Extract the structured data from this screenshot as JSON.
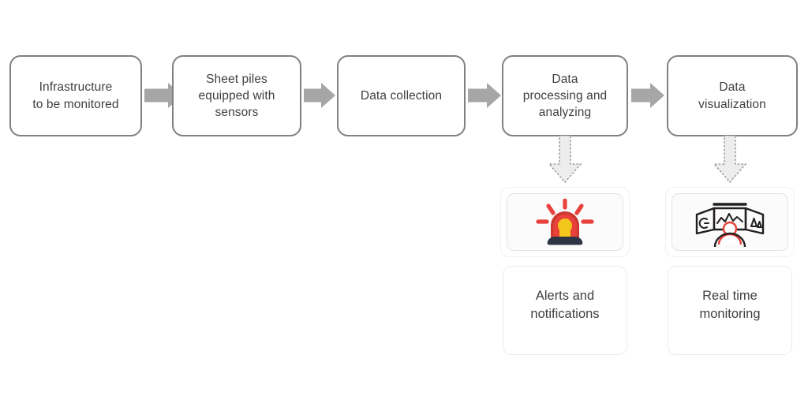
{
  "diagram": {
    "type": "flowchart",
    "orientation": "left-to-right with downward branches",
    "process_steps": [
      {
        "id": "infrastructure",
        "label": "Infrastructure\nto be monitored",
        "lines": [
          "Infrastructure",
          "to be monitored"
        ]
      },
      {
        "id": "sheet-piles",
        "label": "Sheet piles\nequipped with\nsensors",
        "lines": [
          "Sheet piles",
          "equipped with",
          "sensors"
        ]
      },
      {
        "id": "data-collection",
        "label": "Data collection",
        "lines": [
          "Data collection"
        ]
      },
      {
        "id": "data-processing",
        "label": "Data\nprocessing and\nanalyzing",
        "lines": [
          "Data",
          "processing and",
          "analyzing"
        ]
      },
      {
        "id": "data-visualization",
        "label": "Data\nvisualization",
        "lines": [
          "Data",
          "visualization"
        ]
      }
    ],
    "outcomes": [
      {
        "id": "alerts",
        "icon_name": "siren-alert-icon",
        "label": "Alerts and\nnotifications",
        "lines": [
          "Alerts and",
          "notifications"
        ],
        "source_step": "data-processing"
      },
      {
        "id": "realtime",
        "icon_name": "control-room-monitoring-icon",
        "label": "Real time\nmonitoring",
        "lines": [
          "Real time",
          "monitoring"
        ],
        "source_step": "data-visualization"
      }
    ],
    "connectors": {
      "horizontal_arrow_count": 4,
      "horizontal_arrow_style": "solid block arrow",
      "vertical_arrow_count": 2,
      "vertical_arrow_style": "dashed outline block arrow"
    }
  },
  "colors": {
    "box_border": "#808080",
    "box_fill": "#ffffff",
    "text": "#3f3f3f",
    "solid_arrow": "#a6a6a6",
    "dashed_arrow_fill": "#ededed",
    "dashed_arrow_stroke": "#9e9e9e",
    "card_border": "#ececec",
    "icon_card_border": "#e3e3e3",
    "siren_red": "#e8413b",
    "siren_red_dark": "#c9372f",
    "siren_yellow": "#f3c61c",
    "siren_base": "#2d3544",
    "monitor_outline": "#231f20",
    "monitor_accent_red": "#e8413b"
  }
}
